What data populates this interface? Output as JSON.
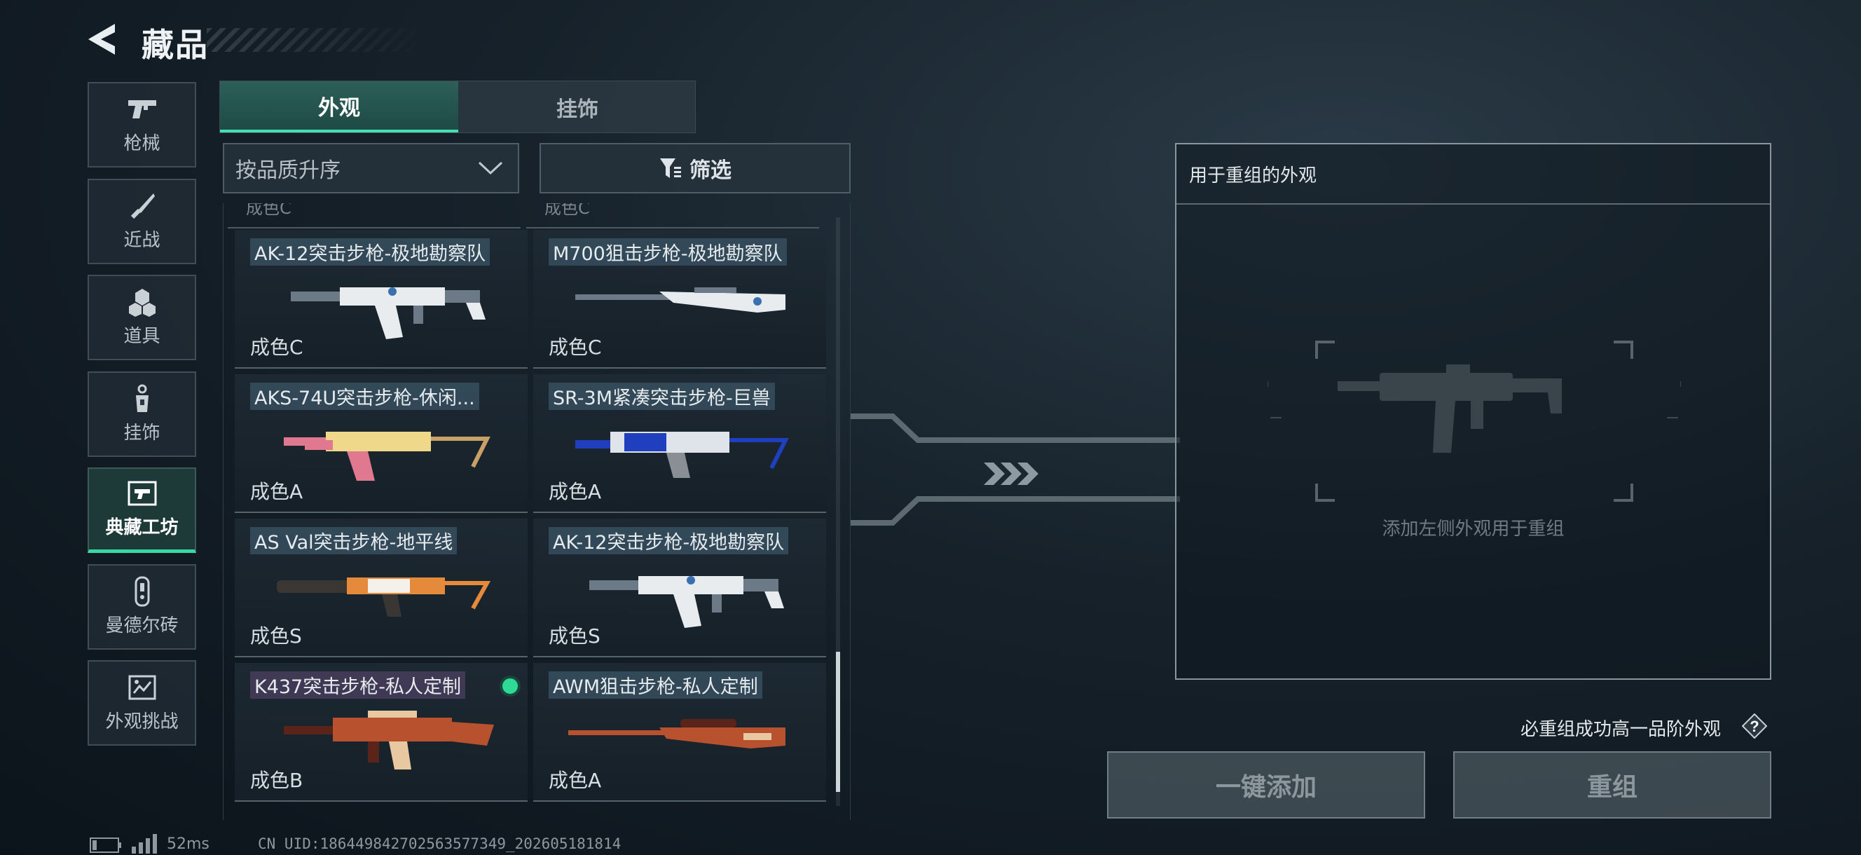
{
  "header": {
    "title": "藏品"
  },
  "sidebar": {
    "items": [
      {
        "label": "枪械",
        "icon": "pistol-icon"
      },
      {
        "label": "近战",
        "icon": "knife-icon"
      },
      {
        "label": "道具",
        "icon": "grenade-icon"
      },
      {
        "label": "挂饰",
        "icon": "charm-icon"
      },
      {
        "label": "典藏工坊",
        "icon": "workshop-icon",
        "active": true
      },
      {
        "label": "曼德尔砖",
        "icon": "mandel-brick-icon"
      },
      {
        "label": "外观挑战",
        "icon": "challenge-icon"
      }
    ]
  },
  "tabs": [
    {
      "label": "外观",
      "active": true
    },
    {
      "label": "挂饰",
      "active": false
    }
  ],
  "sort": {
    "value": "按品质升序"
  },
  "filter": {
    "label": "筛选"
  },
  "list": {
    "partial_top": [
      "成色C",
      "成色C"
    ],
    "items": [
      {
        "name": "AK-12突击步枪-极地勘察队",
        "grade": "成色C",
        "palette": "arctic"
      },
      {
        "name": "M700狙击步枪-极地勘察队",
        "grade": "成色C",
        "palette": "arctic"
      },
      {
        "name": "AKS-74U突击步枪-休闲...",
        "grade": "成色A",
        "palette": "sunset"
      },
      {
        "name": "SR-3M紧凑突击步枪-巨兽",
        "grade": "成色A",
        "palette": "beast"
      },
      {
        "name": "AS Val突击步枪-地平线",
        "grade": "成色S",
        "palette": "horizon"
      },
      {
        "name": "AK-12突击步枪-极地勘察队",
        "grade": "成色S",
        "palette": "arctic"
      },
      {
        "name": "K437突击步枪-私人定制",
        "grade": "成色B",
        "palette": "custom",
        "selected": true
      },
      {
        "name": "AWM狙击步枪-私人定制",
        "grade": "成色A",
        "palette": "custom"
      }
    ]
  },
  "recombine": {
    "title": "用于重组的外观",
    "hint": "添加左侧外观用于重组"
  },
  "promise": "必重组成功高一品阶外观",
  "help": "?",
  "buttons": {
    "add_all": "一键添加",
    "recombine": "重组"
  },
  "status": {
    "ping": "52ms",
    "uid": "CN UID:1864498427025635773​49_202605181814"
  },
  "colors": {
    "accent": "#38d8a6",
    "selected_check": "#2fd996"
  }
}
